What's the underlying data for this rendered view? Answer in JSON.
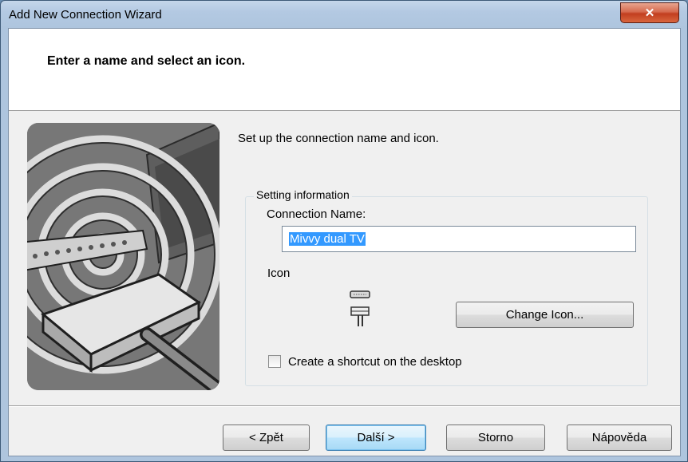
{
  "window": {
    "title": "Add New Connection Wizard",
    "close_glyph": "✕"
  },
  "header": {
    "title": "Enter a name and select an icon."
  },
  "main": {
    "intro": "Set up the connection name and icon.",
    "group_title": "Setting information",
    "connection_name_label": "Connection Name:",
    "connection_name_value": "Mivvy dual TV",
    "icon_label": "Icon",
    "change_icon_button": "Change Icon...",
    "shortcut_checkbox_label": "Create a shortcut on the desktop",
    "shortcut_checked": false
  },
  "footer": {
    "back_button": "< Zpět",
    "next_button": "Další >",
    "cancel_button": "Storno",
    "help_button": "Nápověda"
  },
  "colors": {
    "selection": "#3399ff",
    "close_button": "#c23e1f"
  },
  "icons": {
    "connection_icon": "connector-plug-icon",
    "illustration": "wireless-connection-illustration"
  }
}
